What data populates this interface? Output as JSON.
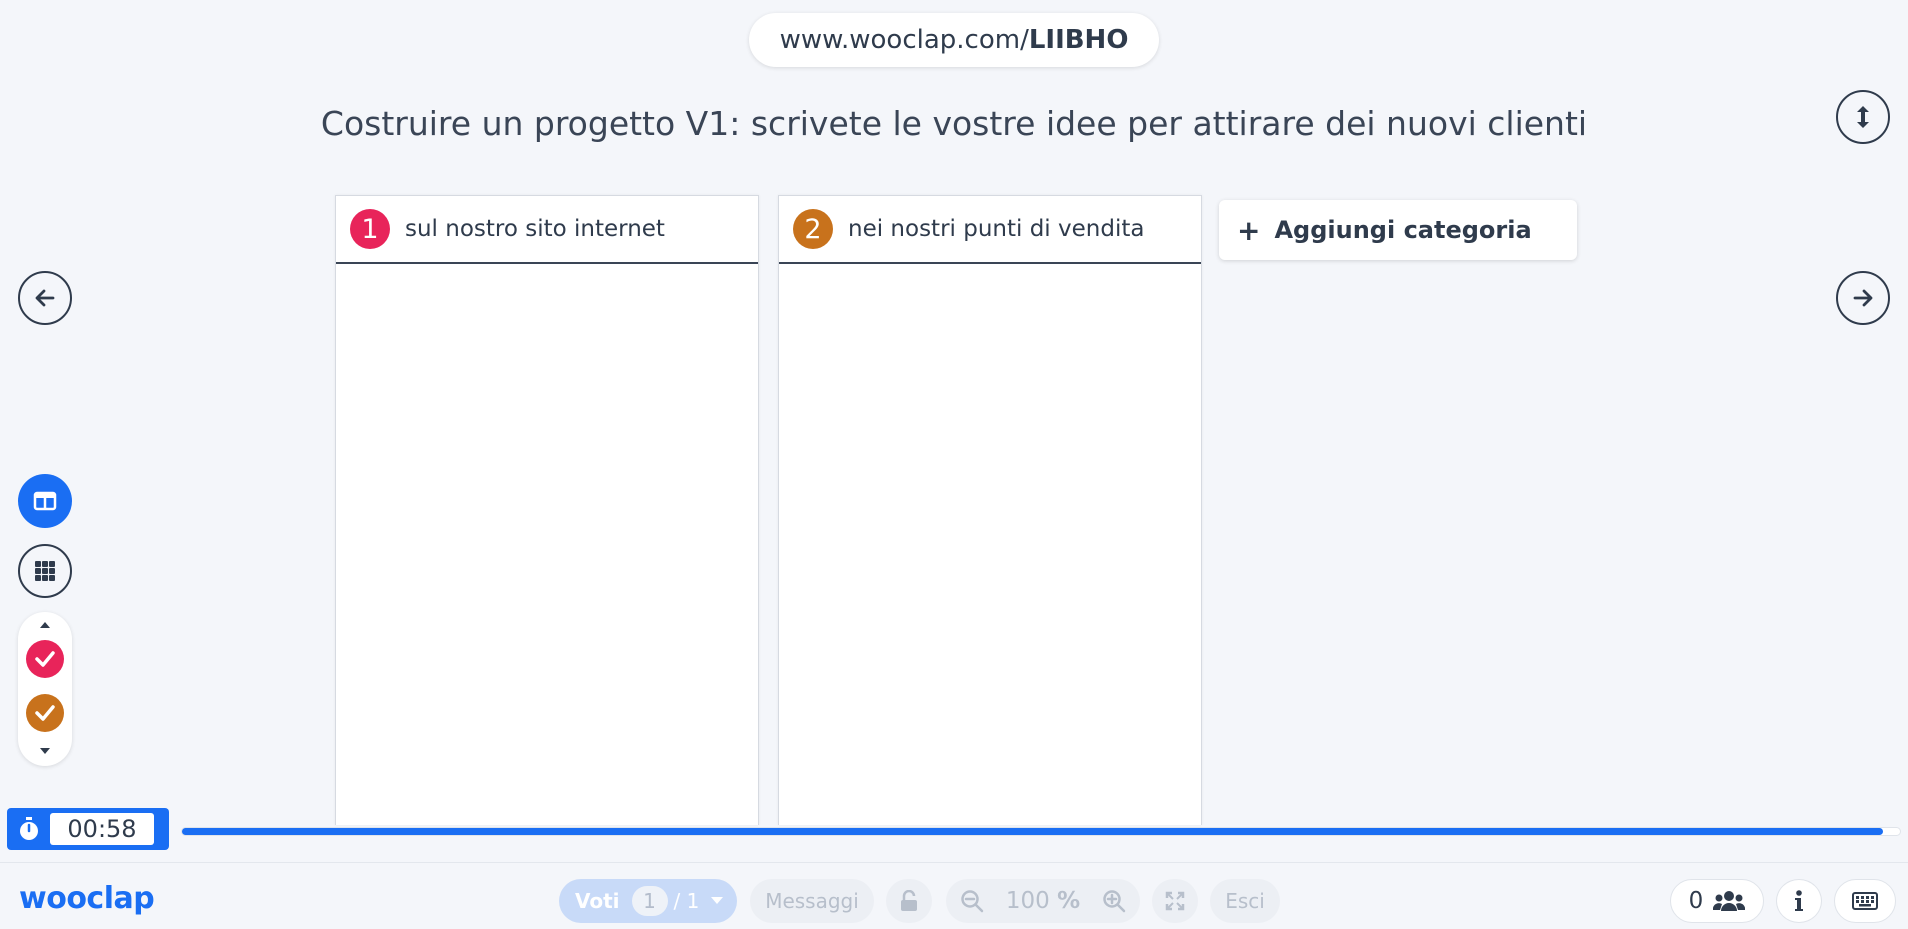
{
  "url": {
    "prefix": "www.wooclap.com/",
    "code": "LIIBHO"
  },
  "question": "Costruire un progetto V1: scrivete le vostre idee per attirare dei nuovi clienti",
  "categories": [
    {
      "number": "1",
      "title": "sul nostro sito internet",
      "color": "#e8245a"
    },
    {
      "number": "2",
      "title": "nei nostri punti di vendita",
      "color": "#c8721c"
    }
  ],
  "add_category": {
    "plus": "+",
    "label": "Aggiungi categoria"
  },
  "timer": {
    "value": "00:58",
    "progress_fraction": 0.99
  },
  "footer": {
    "logo": "wooclap",
    "votes_label": "Voti",
    "votes_page": "1",
    "votes_total": "/ 1",
    "messages_label": "Messaggi",
    "zoom_value": "100",
    "zoom_unit": "%",
    "exit_label": "Esci",
    "participants_count": "0"
  },
  "colors": {
    "accent": "#1a6ef3",
    "cat1": "#e8245a",
    "cat2": "#c8721c"
  }
}
